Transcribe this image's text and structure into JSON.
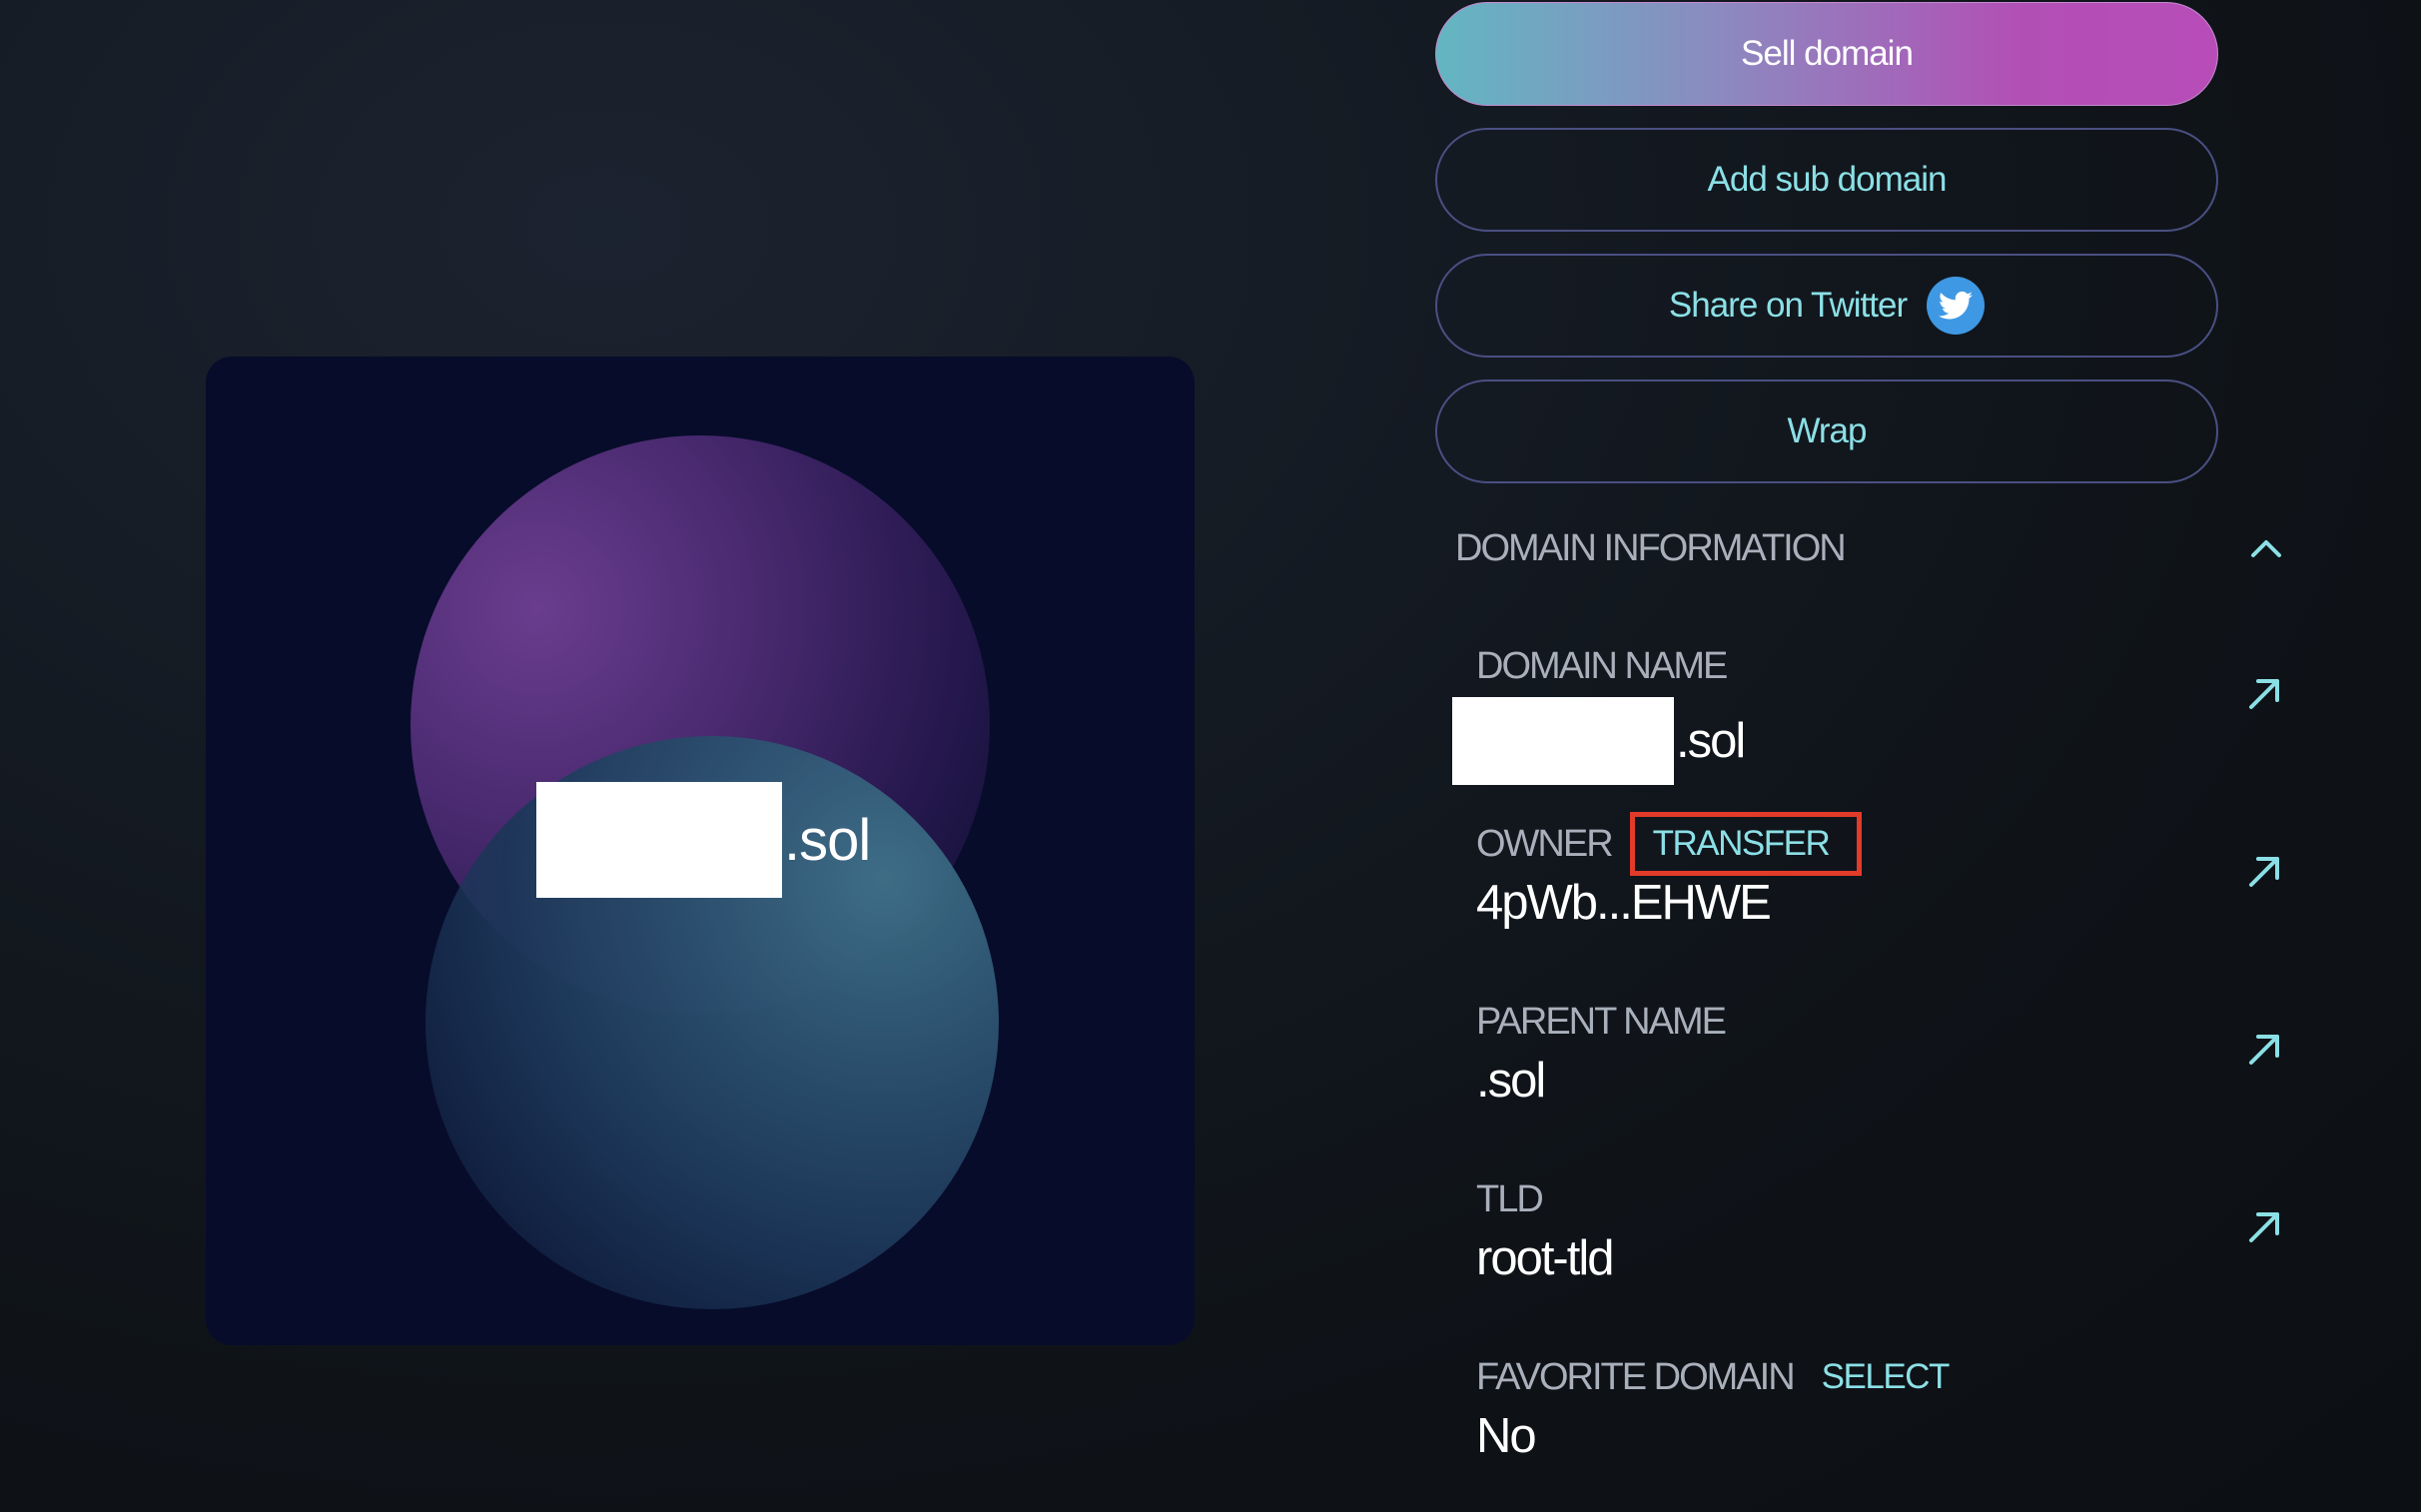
{
  "card": {
    "tld_suffix": ".sol"
  },
  "actions": {
    "sell_label": "Sell domain",
    "add_sub_label": "Add sub domain",
    "share_label": "Share on Twitter",
    "wrap_label": "Wrap"
  },
  "info": {
    "section_title": "DOMAIN INFORMATION",
    "rows": [
      {
        "label": "DOMAIN NAME",
        "value": ".sol"
      },
      {
        "label": "OWNER",
        "action": "TRANSFER",
        "value": "4pWb...EHWE"
      },
      {
        "label": "PARENT NAME",
        "value": ".sol"
      },
      {
        "label": "TLD",
        "value": "root-tld"
      },
      {
        "label": "FAVORITE DOMAIN",
        "action": "SELECT",
        "value": "No"
      }
    ]
  },
  "icons": {
    "twitter": "twitter-bird-icon",
    "collapse": "chevron-up-icon",
    "external_link": "arrow-up-right-icon"
  },
  "colors": {
    "accent_cyan": "#8be0e6",
    "highlight_red": "#e23b2a",
    "twitter_blue": "#3f98e3",
    "gradient_start": "#63b6c2",
    "gradient_end": "#b84db8",
    "card_background": "#070c2a"
  }
}
